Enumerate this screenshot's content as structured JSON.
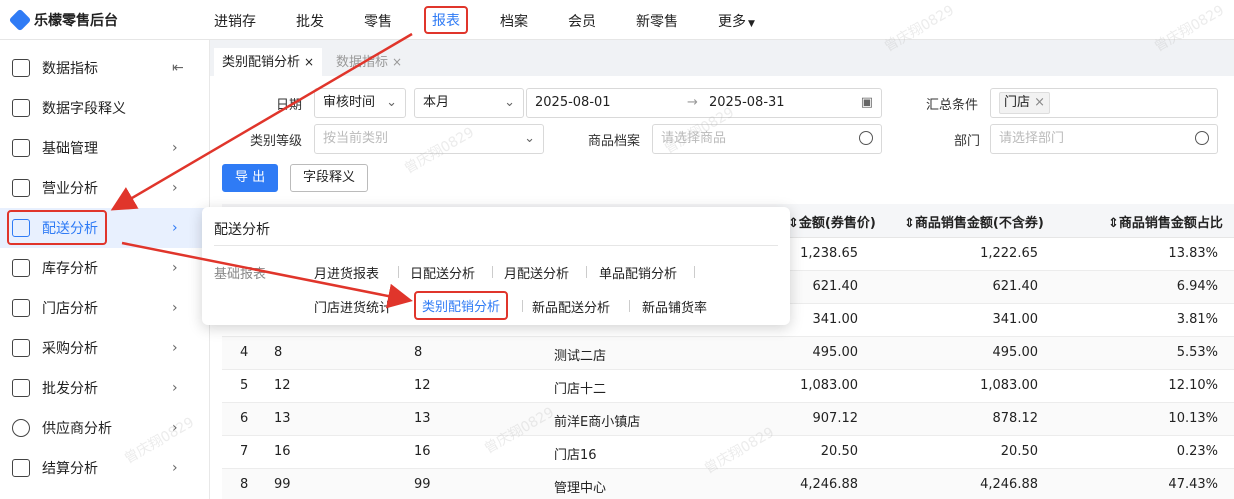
{
  "brand": {
    "name": "乐檬零售后台"
  },
  "topnav": [
    "进销存",
    "批发",
    "零售",
    "报表",
    "档案",
    "会员",
    "新零售",
    "更多"
  ],
  "sidebar": [
    "数据指标",
    "数据字段释义",
    "基础管理",
    "营业分析",
    "配送分析",
    "库存分析",
    "门店分析",
    "采购分析",
    "批发分析",
    "供应商分析",
    "结算分析"
  ],
  "tabs": [
    {
      "label": "类别配销分析",
      "close": "×"
    },
    {
      "label": "数据指标",
      "close": "×"
    }
  ],
  "filters": {
    "date_label": "日期",
    "date_type": "审核时间",
    "period": "本月",
    "start_date": "2025-08-01",
    "range_sep": "→",
    "end_date": "2025-08-31",
    "summary_label": "汇总条件",
    "summary_tag": "门店",
    "category_level_label": "类别等级",
    "category_level_placeholder": "按当前类别",
    "product_label": "商品档案",
    "product_placeholder": "请选择商品",
    "dept_label": "部门",
    "dept_placeholder": "请选择部门"
  },
  "buttons": {
    "export": "导 出",
    "field_def": "字段释义"
  },
  "table": {
    "headers": [
      "金额(券售价)",
      "商品销售金额(不含券)",
      "商品销售金额占比"
    ],
    "rows": [
      {
        "idx": "",
        "code": "",
        "code2": "",
        "name": "",
        "amount": "1,238.65",
        "amount_ex": "1,222.65",
        "ratio": "13.83%"
      },
      {
        "idx": "",
        "code": "",
        "code2": "",
        "name": "",
        "amount": "621.40",
        "amount_ex": "621.40",
        "ratio": "6.94%"
      },
      {
        "idx": "",
        "code": "",
        "code2": "",
        "name": "",
        "amount": "341.00",
        "amount_ex": "341.00",
        "ratio": "3.81%"
      },
      {
        "idx": "4",
        "code": "8",
        "code2": "8",
        "name": "测试二店",
        "amount": "495.00",
        "amount_ex": "495.00",
        "ratio": "5.53%"
      },
      {
        "idx": "5",
        "code": "12",
        "code2": "12",
        "name": "门店十二",
        "amount": "1,083.00",
        "amount_ex": "1,083.00",
        "ratio": "12.10%"
      },
      {
        "idx": "6",
        "code": "13",
        "code2": "13",
        "name": "前洋E商小镇店",
        "amount": "907.12",
        "amount_ex": "878.12",
        "ratio": "10.13%"
      },
      {
        "idx": "7",
        "code": "16",
        "code2": "16",
        "name": "门店16",
        "amount": "20.50",
        "amount_ex": "20.50",
        "ratio": "0.23%"
      },
      {
        "idx": "8",
        "code": "99",
        "code2": "99",
        "name": "管理中心",
        "amount": "4,246.88",
        "amount_ex": "4,246.88",
        "ratio": "47.43%"
      }
    ]
  },
  "popup": {
    "title": "配送分析",
    "group": "基础报表",
    "items": [
      "月进货报表",
      "日配送分析",
      "月配送分析",
      "单品配销分析",
      "门店进货统计",
      "类别配销分析",
      "新品配送分析",
      "新品铺货率"
    ]
  },
  "watermark": "曾庆翔0829"
}
